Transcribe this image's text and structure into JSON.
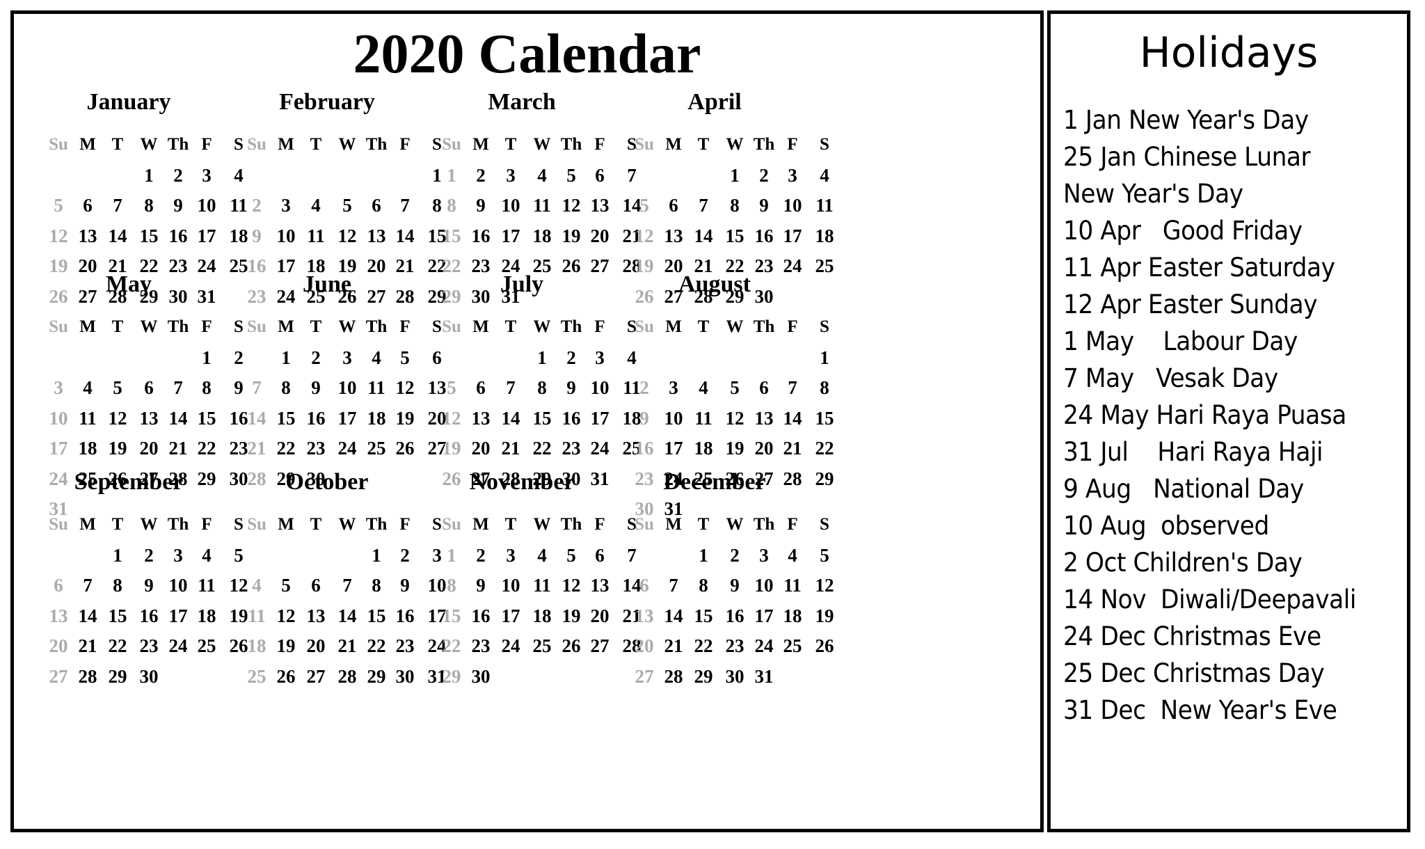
{
  "calendar": {
    "title": "2020 Calendar",
    "weekday_headers": [
      "Su",
      "M",
      "T",
      "W",
      "Th",
      "F",
      "S"
    ],
    "months": [
      {
        "name": "January",
        "weeks": [
          [
            "",
            "",
            "",
            "1",
            "2",
            "3",
            "4"
          ],
          [
            "5",
            "6",
            "7",
            "8",
            "9",
            "10",
            "11"
          ],
          [
            "12",
            "13",
            "14",
            "15",
            "16",
            "17",
            "18"
          ],
          [
            "19",
            "20",
            "21",
            "22",
            "23",
            "24",
            "25"
          ],
          [
            "26",
            "27",
            "28",
            "29",
            "30",
            "31",
            ""
          ]
        ]
      },
      {
        "name": "February",
        "weeks": [
          [
            "",
            "",
            "",
            "",
            "",
            "",
            "1"
          ],
          [
            "2",
            "3",
            "4",
            "5",
            "6",
            "7",
            "8"
          ],
          [
            "9",
            "10",
            "11",
            "12",
            "13",
            "14",
            "15"
          ],
          [
            "16",
            "17",
            "18",
            "19",
            "20",
            "21",
            "22"
          ],
          [
            "23",
            "24",
            "25",
            "26",
            "27",
            "28",
            "29"
          ]
        ]
      },
      {
        "name": "March",
        "weeks": [
          [
            "1",
            "2",
            "3",
            "4",
            "5",
            "6",
            "7"
          ],
          [
            "8",
            "9",
            "10",
            "11",
            "12",
            "13",
            "14"
          ],
          [
            "15",
            "16",
            "17",
            "18",
            "19",
            "20",
            "21"
          ],
          [
            "22",
            "23",
            "24",
            "25",
            "26",
            "27",
            "28"
          ],
          [
            "29",
            "30",
            "31",
            "",
            "",
            "",
            ""
          ]
        ]
      },
      {
        "name": "April",
        "weeks": [
          [
            "",
            "",
            "",
            "1",
            "2",
            "3",
            "4"
          ],
          [
            "5",
            "6",
            "7",
            "8",
            "9",
            "10",
            "11"
          ],
          [
            "12",
            "13",
            "14",
            "15",
            "16",
            "17",
            "18"
          ],
          [
            "19",
            "20",
            "21",
            "22",
            "23",
            "24",
            "25"
          ],
          [
            "26",
            "27",
            "28",
            "29",
            "30",
            "",
            ""
          ]
        ]
      },
      {
        "name": "May",
        "weeks": [
          [
            "",
            "",
            "",
            "",
            "",
            "1",
            "2"
          ],
          [
            "3",
            "4",
            "5",
            "6",
            "7",
            "8",
            "9"
          ],
          [
            "10",
            "11",
            "12",
            "13",
            "14",
            "15",
            "16"
          ],
          [
            "17",
            "18",
            "19",
            "20",
            "21",
            "22",
            "23"
          ],
          [
            "24",
            "25",
            "26",
            "27",
            "28",
            "29",
            "30"
          ],
          [
            "31",
            "",
            "",
            "",
            "",
            "",
            ""
          ]
        ]
      },
      {
        "name": "June",
        "weeks": [
          [
            "",
            "1",
            "2",
            "3",
            "4",
            "5",
            "6"
          ],
          [
            "7",
            "8",
            "9",
            "10",
            "11",
            "12",
            "13"
          ],
          [
            "14",
            "15",
            "16",
            "17",
            "18",
            "19",
            "20"
          ],
          [
            "21",
            "22",
            "23",
            "24",
            "25",
            "26",
            "27"
          ],
          [
            "28",
            "29",
            "30",
            "",
            "",
            "",
            ""
          ]
        ]
      },
      {
        "name": "July",
        "weeks": [
          [
            "",
            "",
            "",
            "1",
            "2",
            "3",
            "4"
          ],
          [
            "5",
            "6",
            "7",
            "8",
            "9",
            "10",
            "11"
          ],
          [
            "12",
            "13",
            "14",
            "15",
            "16",
            "17",
            "18"
          ],
          [
            "19",
            "20",
            "21",
            "22",
            "23",
            "24",
            "25"
          ],
          [
            "26",
            "27",
            "28",
            "29",
            "30",
            "31",
            ""
          ]
        ]
      },
      {
        "name": "August",
        "weeks": [
          [
            "",
            "",
            "",
            "",
            "",
            "",
            "1"
          ],
          [
            "2",
            "3",
            "4",
            "5",
            "6",
            "7",
            "8"
          ],
          [
            "9",
            "10",
            "11",
            "12",
            "13",
            "14",
            "15"
          ],
          [
            "16",
            "17",
            "18",
            "19",
            "20",
            "21",
            "22"
          ],
          [
            "23",
            "24",
            "25",
            "26",
            "27",
            "28",
            "29"
          ],
          [
            "30",
            "31",
            "",
            "",
            "",
            "",
            ""
          ]
        ]
      },
      {
        "name": "September",
        "weeks": [
          [
            "",
            "",
            "1",
            "2",
            "3",
            "4",
            "5"
          ],
          [
            "6",
            "7",
            "8",
            "9",
            "10",
            "11",
            "12"
          ],
          [
            "13",
            "14",
            "15",
            "16",
            "17",
            "18",
            "19"
          ],
          [
            "20",
            "21",
            "22",
            "23",
            "24",
            "25",
            "26"
          ],
          [
            "27",
            "28",
            "29",
            "30",
            "",
            "",
            ""
          ]
        ]
      },
      {
        "name": "October",
        "weeks": [
          [
            "",
            "",
            "",
            "",
            "1",
            "2",
            "3"
          ],
          [
            "4",
            "5",
            "6",
            "7",
            "8",
            "9",
            "10"
          ],
          [
            "11",
            "12",
            "13",
            "14",
            "15",
            "16",
            "17"
          ],
          [
            "18",
            "19",
            "20",
            "21",
            "22",
            "23",
            "24"
          ],
          [
            "25",
            "26",
            "27",
            "28",
            "29",
            "30",
            "31"
          ]
        ]
      },
      {
        "name": "November",
        "weeks": [
          [
            "1",
            "2",
            "3",
            "4",
            "5",
            "6",
            "7"
          ],
          [
            "8",
            "9",
            "10",
            "11",
            "12",
            "13",
            "14"
          ],
          [
            "15",
            "16",
            "17",
            "18",
            "19",
            "20",
            "21"
          ],
          [
            "22",
            "23",
            "24",
            "25",
            "26",
            "27",
            "28"
          ],
          [
            "29",
            "30",
            "",
            "",
            "",
            "",
            ""
          ]
        ]
      },
      {
        "name": "December",
        "weeks": [
          [
            "",
            "",
            "1",
            "2",
            "3",
            "4",
            "5"
          ],
          [
            "6",
            "7",
            "8",
            "9",
            "10",
            "11",
            "12"
          ],
          [
            "13",
            "14",
            "15",
            "16",
            "17",
            "18",
            "19"
          ],
          [
            "20",
            "21",
            "22",
            "23",
            "24",
            "25",
            "26"
          ],
          [
            "27",
            "28",
            "29",
            "30",
            "31",
            "",
            ""
          ]
        ]
      }
    ]
  },
  "holidays": {
    "title": "Holidays",
    "lines": [
      "1 Jan New Year's Day",
      "25 Jan Chinese Lunar",
      "New Year's Day",
      "10 Apr   Good Friday",
      "11 Apr Easter Saturday",
      "12 Apr Easter Sunday",
      "1 May    Labour Day",
      "7 May   Vesak Day",
      "24 May Hari Raya Puasa",
      "31 Jul    Hari Raya Haji",
      "9 Aug   National Day",
      "10 Aug  observed",
      "2 Oct Children's Day",
      "14 Nov  Diwali/Deepavali",
      "24 Dec Christmas Eve",
      "25 Dec Christmas Day",
      "31 Dec  New Year's Eve"
    ]
  },
  "colors": {
    "weekday_text": "#000000",
    "sunday_text": "#ababab",
    "border": "#000000"
  }
}
